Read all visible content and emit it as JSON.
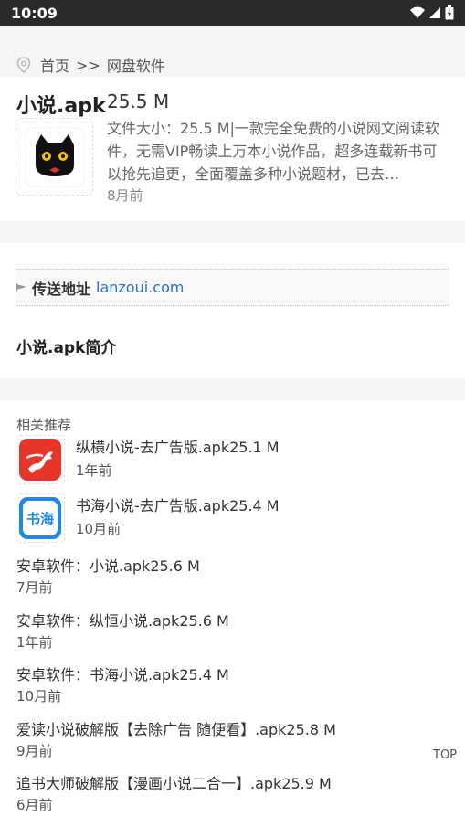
{
  "statusbar": {
    "time": "10:09"
  },
  "breadcrumb": {
    "home": "首页",
    "separator": ">>",
    "category": "网盘软件"
  },
  "file": {
    "name": "小说.apk",
    "size": "25.5 M",
    "description": "文件大小：25.5 M|一款完全免费的小说网文阅读软件，无需VIP畅读上万本小说作品，超多连载新书可以抢先追更，全面覆盖多种小说题材，已去…",
    "time": "8月前"
  },
  "link": {
    "label": "传送地址",
    "url": "lanzoui.com"
  },
  "intro_title": "小说.apk简介",
  "recommend": {
    "title": "相关推荐",
    "apps": [
      {
        "name": "纵横小说-去广告版.apk25.1 M",
        "time": "1年前",
        "icon": "zongheng-horse-icon"
      },
      {
        "name": "书海小说-去广告版.apk25.4 M",
        "time": "10月前",
        "icon": "shuhai-icon",
        "icon_text": "书海"
      }
    ],
    "items": [
      {
        "name": "安卓软件：小说.apk25.6 M",
        "time": "7月前"
      },
      {
        "name": "安卓软件：纵恒小说.apk25.6 M",
        "time": "1年前"
      },
      {
        "name": "安卓软件：书海小说.apk25.4 M",
        "time": "10月前"
      },
      {
        "name": "爱读小说破解版【去除广告 随便看】.apk25.8 M",
        "time": "9月前"
      },
      {
        "name": "追书大师破解版【漫画小说二合一】.apk25.9 M",
        "time": "6月前"
      }
    ]
  },
  "top_button": "TOP",
  "colors": {
    "link": "#2a6fd6",
    "statusbar": "#2a2a2a",
    "zongheng_red": "#e8352a",
    "shuhai_blue": "#1e88e5"
  }
}
